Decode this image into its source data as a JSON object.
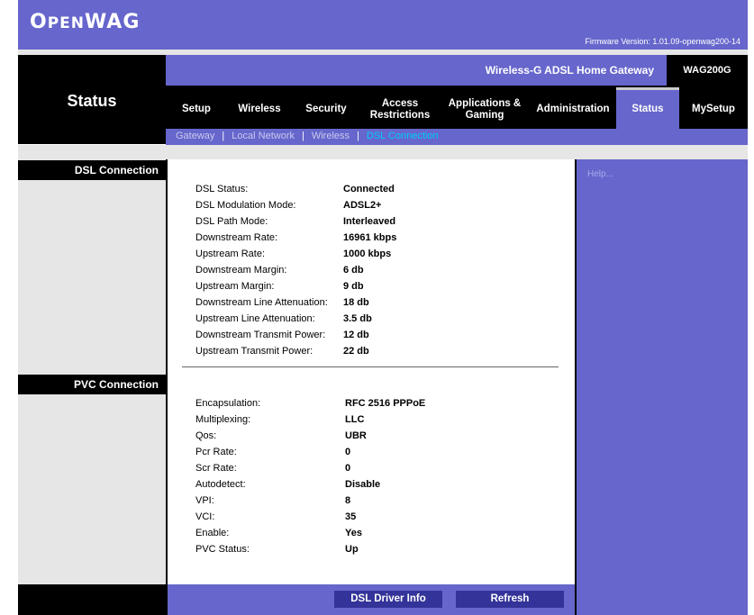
{
  "header": {
    "logo": "OPENWAG",
    "firmware": "Firmware Version: 1.01.09-openwag200-14",
    "product_name": "Wireless-G ADSL Home Gateway",
    "model": "WAG200G",
    "section_title": "Status"
  },
  "nav": {
    "tabs": [
      {
        "label": "Setup"
      },
      {
        "label": "Wireless"
      },
      {
        "label": "Security"
      },
      {
        "label": "Access\nRestrictions"
      },
      {
        "label": "Applications &\nGaming"
      },
      {
        "label": "Administration"
      },
      {
        "label": "Status"
      },
      {
        "label": "MySetup"
      }
    ],
    "active_tab": "Status"
  },
  "subnav": {
    "items": [
      {
        "label": "Gateway"
      },
      {
        "label": "Local Network"
      },
      {
        "label": "Wireless"
      },
      {
        "label": "DSL Connection"
      }
    ],
    "separator": "|",
    "current": "DSL Connection"
  },
  "sections": {
    "dsl": {
      "title": "DSL Connection",
      "rows": [
        {
          "label": "DSL Status:",
          "value": "Connected"
        },
        {
          "label": "DSL Modulation Mode:",
          "value": "ADSL2+"
        },
        {
          "label": "DSL Path Mode:",
          "value": "Interleaved"
        },
        {
          "label": "Downstream Rate:",
          "value": "16961 kbps"
        },
        {
          "label": "Upstream Rate:",
          "value": "1000 kbps"
        },
        {
          "label": "Downstream Margin:",
          "value": "6 db"
        },
        {
          "label": "Upstream Margin:",
          "value": "9 db"
        },
        {
          "label": "Downstream Line Attenuation:",
          "value": "18 db"
        },
        {
          "label": "Upstream Line Attenuation:",
          "value": "3.5 db"
        },
        {
          "label": "Downstream Transmit Power:",
          "value": "12 db"
        },
        {
          "label": "Upstream Transmit Power:",
          "value": "22 db"
        }
      ]
    },
    "pvc": {
      "title": "PVC Connection",
      "rows": [
        {
          "label": "Encapsulation:",
          "value": "RFC 2516 PPPoE"
        },
        {
          "label": "Multiplexing:",
          "value": "LLC"
        },
        {
          "label": "Qos:",
          "value": "UBR"
        },
        {
          "label": "Pcr Rate:",
          "value": "0"
        },
        {
          "label": "Scr Rate:",
          "value": "0"
        },
        {
          "label": "Autodetect:",
          "value": "Disable"
        },
        {
          "label": "VPI:",
          "value": "8"
        },
        {
          "label": "VCI:",
          "value": "35"
        },
        {
          "label": "Enable:",
          "value": "Yes"
        },
        {
          "label": "PVC Status:",
          "value": "Up"
        }
      ]
    }
  },
  "help": {
    "label": "Help..."
  },
  "footer": {
    "driver_button": "DSL Driver Info",
    "refresh_button": "Refresh"
  },
  "colors": {
    "accent": "#6666cc",
    "dark": "#000000",
    "panel": "#e6e6e6",
    "subnav_current": "#00ccff",
    "button": "#333399"
  }
}
